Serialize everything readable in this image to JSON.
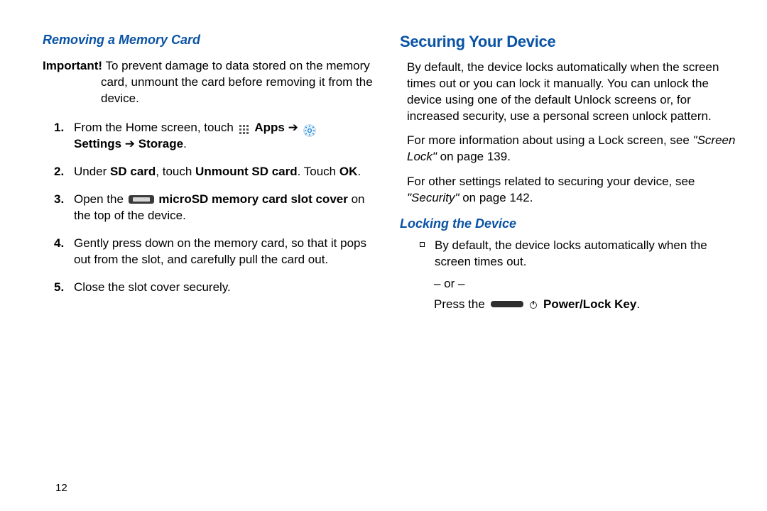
{
  "left": {
    "subheading": "Removing a Memory Card",
    "important_label": "Important!",
    "important_line1": " To prevent damage to data stored on the memory",
    "important_line2": "card, unmount the card before removing it from the",
    "important_line3": "device.",
    "steps": {
      "s1_a": "From the Home screen, touch ",
      "s1_apps": "Apps",
      "s1_arrow1": " ➔ ",
      "s1_settings": "Settings",
      "s1_arrow2": " ➔ ",
      "s1_storage": "Storage",
      "s1_period": ".",
      "s2_a": "Under ",
      "s2_sdcard": "SD card",
      "s2_b": ", touch ",
      "s2_unmount": "Unmount SD card",
      "s2_c": ". Touch ",
      "s2_ok": "OK",
      "s2_d": ".",
      "s3_a": "Open the ",
      "s3_slot": "microSD memory card slot cover",
      "s3_b": " on the top of the device.",
      "s4": "Gently press down on the memory card, so that it pops out from the slot, and carefully pull the card out.",
      "s5": "Close the slot cover securely."
    }
  },
  "right": {
    "heading": "Securing Your Device",
    "p1": "By default, the device locks automatically when the screen times out or you can lock it manually. You can unlock the device using one of the default Unlock screens or, for increased security, use a personal screen unlock pattern.",
    "p2_a": "For more information about using a Lock screen, see ",
    "p2_i": "\"Screen Lock\"",
    "p2_b": " on page 139.",
    "p3_a": "For other settings related to securing your device, see ",
    "p3_i": "\"Security\"",
    "p3_b": " on page 142.",
    "sub": "Locking the Device",
    "bullet": "By default, the device locks automatically when the screen times out.",
    "or": "– or –",
    "press_a": "Press the ",
    "press_key": "Power/Lock Key",
    "press_b": "."
  },
  "page_number": "12",
  "icon_names": {
    "apps": "apps-grid-icon",
    "gear": "settings-gear-icon",
    "slot": "microsd-slot-icon",
    "powerkey": "power-lock-key-icon",
    "powersym": "power-symbol-icon"
  }
}
